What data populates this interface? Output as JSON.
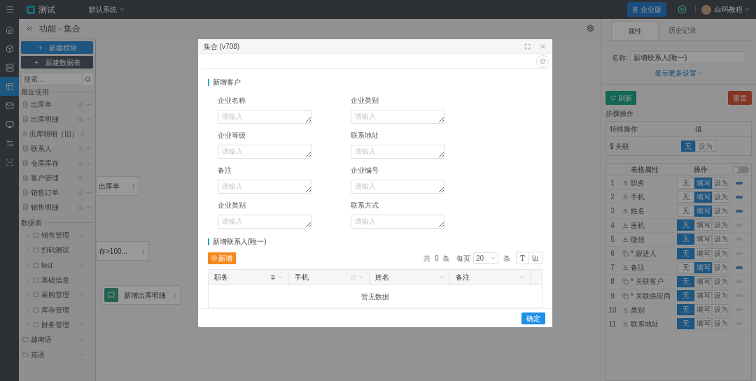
{
  "topbar": {
    "app_name": "测试",
    "system": "默认系统",
    "edition_button": "企业版",
    "user": "白码教程"
  },
  "rail": [
    {
      "selected": false
    },
    {
      "selected": false
    },
    {
      "selected": false
    },
    {
      "selected": true
    },
    {
      "selected": false
    },
    {
      "selected": false
    },
    {
      "selected": false
    },
    {
      "selected": false
    }
  ],
  "page_header": {
    "title": "功能 - 集合"
  },
  "sidebar": {
    "buttons": [
      "新建模块",
      "新建数据表"
    ],
    "search_placeholder": "搜索...",
    "recent_label": "最近使用",
    "recent": [
      "出库单",
      "出库明细",
      "出库明细（旧）",
      "联系人",
      "仓库库存",
      "客户管理",
      "销售订单",
      "销售明细"
    ],
    "tables_label": "数据表",
    "tables": [
      {
        "name": "销售管理",
        "expandable": true
      },
      {
        "name": "扫码测试",
        "expandable": true
      },
      {
        "name": "test",
        "expandable": true
      },
      {
        "name": "基础信息",
        "expandable": true
      },
      {
        "name": "采购管理",
        "expandable": true
      },
      {
        "name": "库存管理",
        "expandable": true
      },
      {
        "name": "财务管理",
        "expandable": true
      },
      {
        "name": "越南语",
        "expandable": false
      },
      {
        "name": "英语",
        "expandable": false
      }
    ]
  },
  "canvas": {
    "nodes": [
      {
        "text": "出库单",
        "kind": "plain"
      },
      {
        "text": "存>100...",
        "kind": "plain"
      },
      {
        "text": "新增出库明细",
        "kind": "icon"
      }
    ]
  },
  "dialog": {
    "title": "集合 (v708)",
    "section": {
      "title": "新增客户",
      "fields": [
        {
          "label": "企业名称",
          "placeholder": "请输入"
        },
        {
          "label": "企业类别",
          "placeholder": "请输入"
        },
        {
          "label": "企业等级",
          "placeholder": "请输入"
        },
        {
          "label": "联系地址",
          "placeholder": "请输入"
        },
        {
          "label": "备注",
          "placeholder": "请输入"
        },
        {
          "label": "企业编号",
          "placeholder": "请输入"
        },
        {
          "label": "企业类别",
          "placeholder": "请输入"
        },
        {
          "label": "联系方式",
          "placeholder": "请输入"
        }
      ]
    },
    "subtable": {
      "title": "新增联系人(唯一)",
      "add_button": "新增",
      "total": "共",
      "count": "0",
      "unit": "条",
      "per_page": "每页",
      "page_size": "20",
      "per_unit": "条",
      "columns": [
        {
          "label": "职务",
          "kind": "pin"
        },
        {
          "label": "手机",
          "kind": "help"
        },
        {
          "label": "姓名",
          "kind": "plain"
        },
        {
          "label": "备注",
          "kind": "plain"
        }
      ],
      "empty": "暂无数据"
    },
    "confirm": "确定"
  },
  "right_panel": {
    "tabs": [
      {
        "label": "属性",
        "selected": true
      },
      {
        "label": "历史记录",
        "selected": false
      }
    ],
    "name_label": "名称:",
    "name_value": "新增联系人(唯一)",
    "more_link": "显示更多设置",
    "refresh": "刷新",
    "reset": "重置",
    "steps_label": "步骤操作",
    "special_table": {
      "columns": [
        "特殊操作",
        "值"
      ],
      "row": {
        "name": "$ 关联",
        "options": [
          {
            "label": "无",
            "selected": true
          },
          {
            "label": "设为",
            "selected": false
          }
        ]
      }
    },
    "fields_table": {
      "columns": [
        "表格属性",
        "操作"
      ],
      "toggle_on": false,
      "rows": [
        {
          "index": "1",
          "kind": "text",
          "name": "职务",
          "options": [
            {
              "label": "无",
              "selected": false
            },
            {
              "label": "填写",
              "selected": true
            },
            {
              "label": "设为",
              "selected": false
            }
          ],
          "on": true
        },
        {
          "index": "2",
          "kind": "text",
          "name": "手机",
          "options": [
            {
              "label": "无",
              "selected": false
            },
            {
              "label": "填写",
              "selected": true
            },
            {
              "label": "设为",
              "selected": false
            }
          ],
          "on": true
        },
        {
          "index": "3",
          "kind": "text",
          "name": "姓名",
          "options": [
            {
              "label": "无",
              "selected": false
            },
            {
              "label": "填写",
              "selected": true
            },
            {
              "label": "设为",
              "selected": false
            }
          ],
          "on": true
        },
        {
          "index": "4",
          "kind": "text",
          "name": "座机",
          "options": [
            {
              "label": "无",
              "selected": true
            },
            {
              "label": "填写",
              "selected": false
            },
            {
              "label": "设为",
              "selected": false
            }
          ],
          "on": false
        },
        {
          "index": "5",
          "kind": "text",
          "name": "微信",
          "options": [
            {
              "label": "无",
              "selected": true
            },
            {
              "label": "填写",
              "selected": false
            },
            {
              "label": "设为",
              "selected": false
            }
          ],
          "on": false
        },
        {
          "index": "6",
          "kind": "link",
          "name": "* 跟进人",
          "options": [
            {
              "label": "无",
              "selected": true
            },
            {
              "label": "填写",
              "selected": false
            },
            {
              "label": "设为",
              "selected": false
            }
          ],
          "on": false
        },
        {
          "index": "7",
          "kind": "text",
          "name": "备注",
          "options": [
            {
              "label": "无",
              "selected": false
            },
            {
              "label": "填写",
              "selected": true
            },
            {
              "label": "设为",
              "selected": false
            }
          ],
          "on": true
        },
        {
          "index": "8",
          "kind": "link",
          "name": "* 关联客户",
          "options": [
            {
              "label": "无",
              "selected": true
            },
            {
              "label": "填写",
              "selected": false
            },
            {
              "label": "设为",
              "selected": false
            }
          ],
          "on": false
        },
        {
          "index": "9",
          "kind": "link",
          "name": "* 关联供应商",
          "options": [
            {
              "label": "无",
              "selected": true
            },
            {
              "label": "填写",
              "selected": false
            },
            {
              "label": "设为",
              "selected": false
            }
          ],
          "on": false
        },
        {
          "index": "10",
          "kind": "text",
          "name": "类别",
          "options": [
            {
              "label": "无",
              "selected": true
            },
            {
              "label": "填写",
              "selected": false
            },
            {
              "label": "设为",
              "selected": false
            }
          ],
          "on": false
        },
        {
          "index": "11",
          "kind": "text",
          "name": "联系地址",
          "options": [
            {
              "label": "无",
              "selected": true
            },
            {
              "label": "填写",
              "selected": false
            },
            {
              "label": "设为",
              "selected": false
            }
          ],
          "on": false
        }
      ]
    }
  }
}
